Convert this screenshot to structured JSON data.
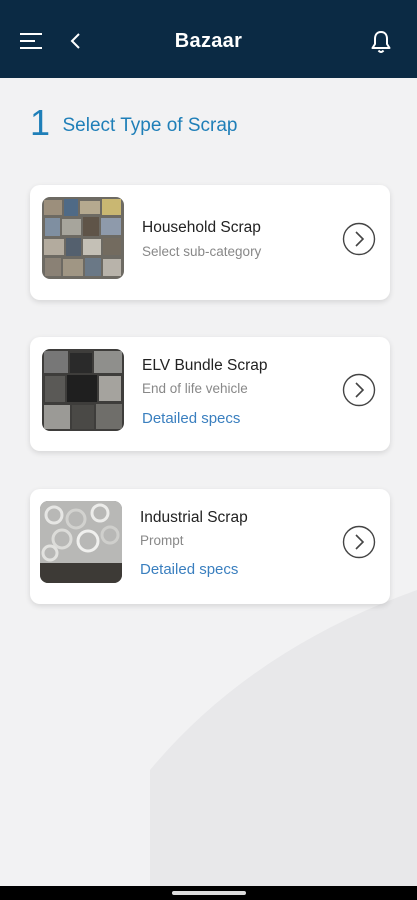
{
  "header": {
    "title": "Bazaar",
    "menu_icon": "hamburger-menu-icon",
    "back_icon": "chevron-left-icon",
    "bell_icon": "bell-icon",
    "background_color": "#0b2a44"
  },
  "step": {
    "number": "1",
    "label": "Select Type of Scrap",
    "color": "#1f7fb8"
  },
  "cards": [
    {
      "name": "Household Scrap",
      "subtitle": "Select sub-category",
      "link": "",
      "icon": "chevron-right-circle-icon"
    },
    {
      "name": "ELV Bundle Scrap",
      "subtitle": "End of life vehicle",
      "link": "Detailed specs",
      "icon": "chevron-right-circle-icon"
    },
    {
      "name": "Industrial Scrap",
      "subtitle": "Prompt",
      "link": "Detailed specs",
      "icon": "chevron-right-circle-icon"
    }
  ],
  "link_color": "#3a7fbf"
}
